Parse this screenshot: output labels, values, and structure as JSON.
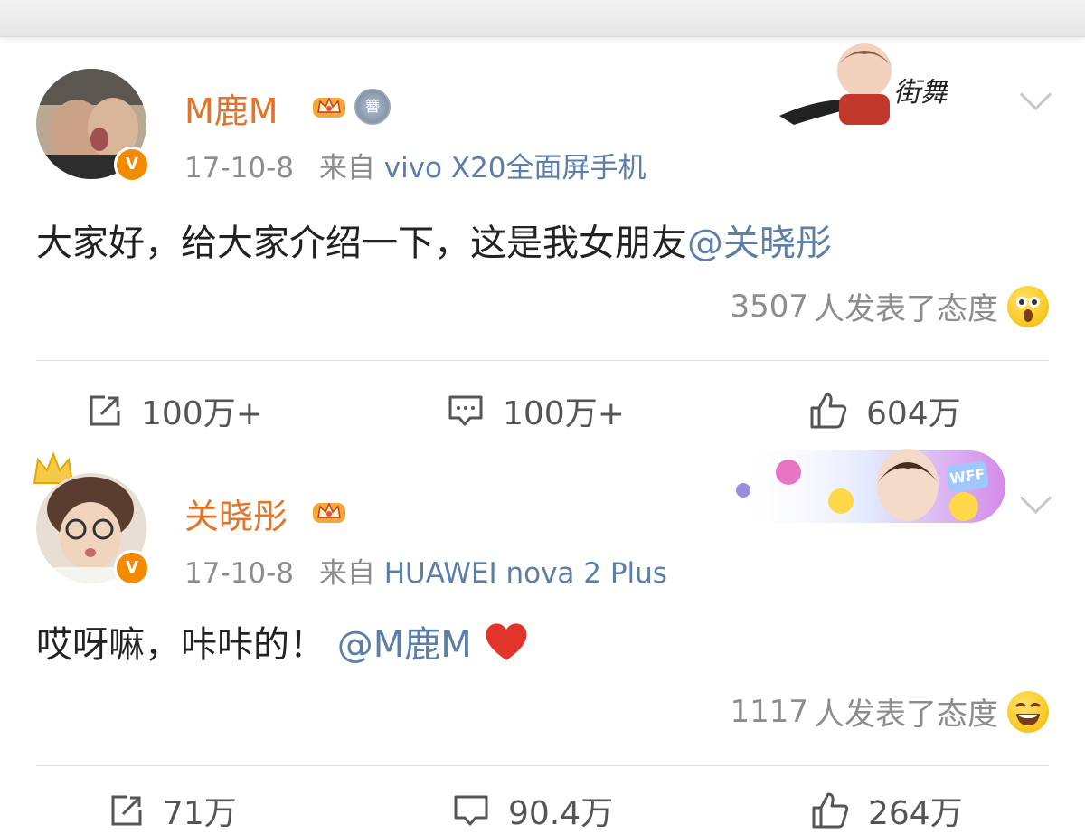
{
  "colors": {
    "username": "#e2752a",
    "mention": "#5b7fa8",
    "meta": "#8d8d8d",
    "badge": "#f28b00"
  },
  "post1": {
    "username": "M鹿M",
    "medal_char": "簪",
    "date": "17-10-8",
    "source_prefix": "来自",
    "device": "vivo X20全面屏手机",
    "text": "大家好，给大家介绍一下，这是我女朋友",
    "mention": "@关晓彤",
    "reaction_count": "3507",
    "reaction_label": "人发表了态度",
    "actions": {
      "repost": "100万+",
      "comment": "100万+",
      "like": "604万"
    }
  },
  "post2": {
    "username": "关晓彤",
    "date": "17-10-8",
    "source_prefix": "来自",
    "device": "HUAWEI nova 2 Plus",
    "text": "哎呀嘛，咔咔的！",
    "mention": "@M鹿M",
    "reaction_count": "1117",
    "reaction_label": "人发表了态度",
    "sticker_text": "WFF",
    "actions": {
      "repost": "71万",
      "comment": "90.4万",
      "like": "264万"
    }
  }
}
